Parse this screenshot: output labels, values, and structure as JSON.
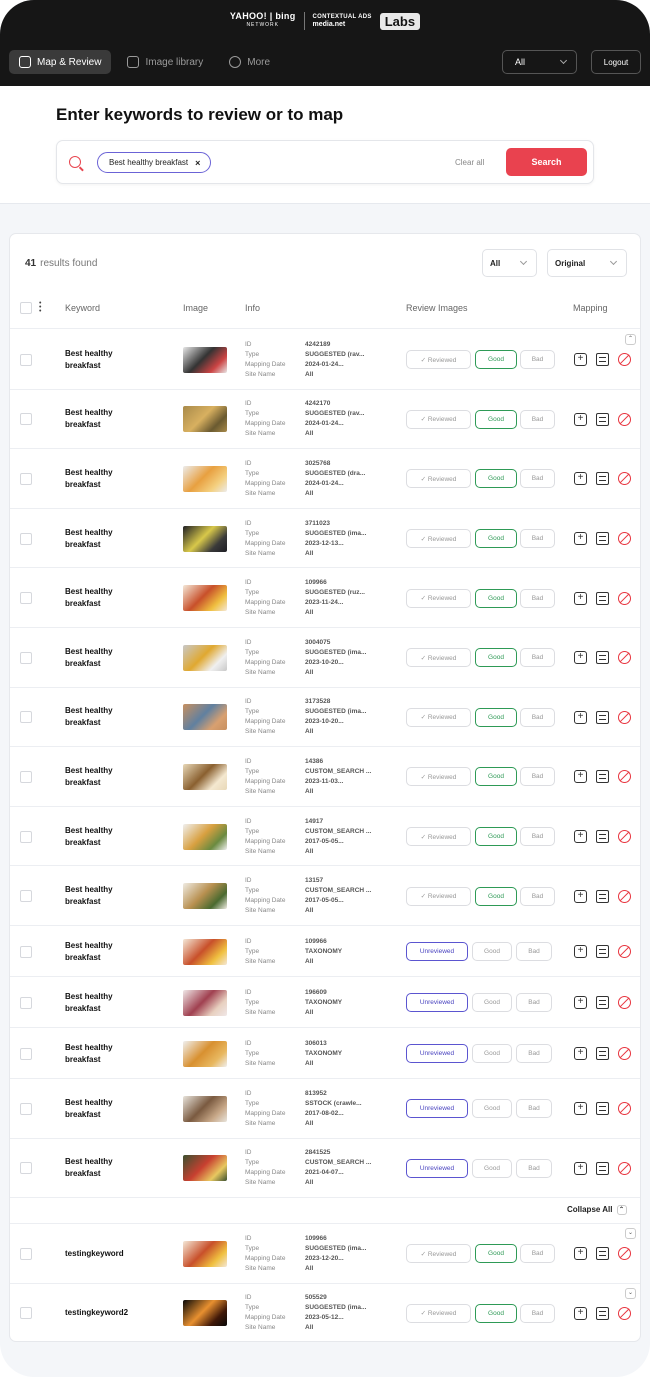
{
  "brand": {
    "yahoo_bing": "YAHOO! | bing",
    "network": "NETWORK",
    "contextual_ads": "CONTEXTUAL ADS",
    "powered_by": "media.net",
    "labs": "Labs"
  },
  "nav": {
    "items": [
      {
        "label": "Map & Review",
        "icon": "map-icon",
        "active": true
      },
      {
        "label": "Image library",
        "icon": "image-icon",
        "active": false
      },
      {
        "label": "More",
        "icon": "more-icon",
        "active": false
      }
    ],
    "select_value": "All",
    "logout_label": "Logout"
  },
  "search": {
    "title": "Enter keywords to review or to map",
    "chip": "Best healthy breakfast",
    "clear_label": "Clear all",
    "search_label": "Search"
  },
  "results": {
    "count": "41",
    "count_label": "results found",
    "filter_status": "All",
    "filter_source": "Original",
    "headers": [
      "Keyword",
      "Image",
      "Info",
      "Review Images",
      "Mapping"
    ],
    "info_labels": [
      "ID",
      "Type",
      "Mapping Date",
      "Site Name"
    ],
    "collapse_all": "Collapse All",
    "button_labels": {
      "reviewed": "Reviewed",
      "unreviewed": "Unreviewed",
      "good": "Good",
      "bad": "Bad"
    },
    "colors": {
      "accent": "#e9424f",
      "good": "#2e9a56",
      "unreviewed": "#5b55d0"
    },
    "rows": [
      {
        "keyword": "Best healthy breakfast",
        "id": "4242189",
        "type": "SUGGESTED (rav...",
        "date": "2024-01-24...",
        "site": "All",
        "status": "reviewed",
        "img": [
          "#e8e8e8",
          "#333",
          "#c44"
        ]
      },
      {
        "keyword": "Best healthy breakfast",
        "id": "4242170",
        "type": "SUGGESTED (rav...",
        "date": "2024-01-24...",
        "site": "All",
        "status": "reviewed",
        "img": [
          "#a88a4a",
          "#d8b060",
          "#6a5a30"
        ]
      },
      {
        "keyword": "Best healthy breakfast",
        "id": "3025768",
        "type": "SUGGESTED (dra...",
        "date": "2024-01-24...",
        "site": "All",
        "status": "reviewed",
        "img": [
          "#ececec",
          "#e8a040",
          "#f4d080"
        ]
      },
      {
        "keyword": "Best healthy breakfast",
        "id": "3711023",
        "type": "SUGGESTED (ima...",
        "date": "2023-12-13...",
        "site": "All",
        "status": "reviewed",
        "img": [
          "#1e1e24",
          "#d8c84a",
          "#3a3a3a"
        ]
      },
      {
        "keyword": "Best healthy breakfast",
        "id": "109966",
        "type": "SUGGESTED (ruz...",
        "date": "2023-11-24...",
        "site": "All",
        "status": "reviewed",
        "img": [
          "#f4e8d8",
          "#c8502a",
          "#f0c040"
        ]
      },
      {
        "keyword": "Best healthy breakfast",
        "id": "3004075",
        "type": "SUGGESTED (ima...",
        "date": "2023-10-20...",
        "site": "All",
        "status": "reviewed",
        "img": [
          "#c8c8c8",
          "#e0a830",
          "#f0f0f0"
        ]
      },
      {
        "keyword": "Best healthy breakfast",
        "id": "3173528",
        "type": "SUGGESTED (ima...",
        "date": "2023-10-20...",
        "site": "All",
        "status": "reviewed",
        "img": [
          "#c89060",
          "#6080a0",
          "#d8a070"
        ]
      },
      {
        "keyword": "Best healthy breakfast",
        "id": "14386",
        "type": "CUSTOM_SEARCH ...",
        "date": "2023-11-03...",
        "site": "All",
        "status": "reviewed",
        "img": [
          "#e8d8b8",
          "#8a6030",
          "#f4e8d0"
        ]
      },
      {
        "keyword": "Best healthy breakfast",
        "id": "14917",
        "type": "CUSTOM_SEARCH ...",
        "date": "2017-05-05...",
        "site": "All",
        "status": "reviewed",
        "img": [
          "#f0f0f0",
          "#d8a040",
          "#6a8a40"
        ]
      },
      {
        "keyword": "Best healthy breakfast",
        "id": "13157",
        "type": "CUSTOM_SEARCH ...",
        "date": "2017-05-05...",
        "site": "All",
        "status": "reviewed",
        "img": [
          "#f0ece4",
          "#b89050",
          "#4a6a30"
        ]
      },
      {
        "keyword": "Best healthy breakfast",
        "id": "109966",
        "type": "TAXONOMY",
        "date": "",
        "site": "All",
        "status": "unreviewed",
        "img": [
          "#f4e8d8",
          "#c8502a",
          "#f0c040"
        ]
      },
      {
        "keyword": "Best healthy breakfast",
        "id": "196609",
        "type": "TAXONOMY",
        "date": "",
        "site": "All",
        "status": "unreviewed",
        "img": [
          "#f0e8e8",
          "#a04050",
          "#e8d0c0"
        ]
      },
      {
        "keyword": "Best healthy breakfast",
        "id": "306013",
        "type": "TAXONOMY",
        "date": "",
        "site": "All",
        "status": "unreviewed",
        "img": [
          "#f0f0f0",
          "#d89030",
          "#e8b860"
        ]
      },
      {
        "keyword": "Best healthy breakfast",
        "id": "813952",
        "type": "SSTOCK (crawle...",
        "date": "2017-08-02...",
        "site": "All",
        "status": "unreviewed",
        "img": [
          "#e8e4dc",
          "#7a5a40",
          "#c8a888"
        ]
      },
      {
        "keyword": "Best healthy breakfast",
        "id": "2841525",
        "type": "CUSTOM_SEARCH ...",
        "date": "2021-04-07...",
        "site": "All",
        "status": "unreviewed",
        "img": [
          "#3a5030",
          "#c84030",
          "#e8c860"
        ]
      }
    ],
    "group_rows": [
      {
        "keyword": "testingkeyword",
        "id": "109966",
        "type": "SUGGESTED (ima...",
        "date": "2023-12-20...",
        "site": "All",
        "status": "reviewed",
        "img": [
          "#f4e8d8",
          "#c8502a",
          "#f0c040"
        ]
      },
      {
        "keyword": "testingkeyword2",
        "id": "505529",
        "type": "SUGGESTED (ima...",
        "date": "2023-05-12...",
        "site": "All",
        "status": "reviewed",
        "img": [
          "#080808",
          "#e89030",
          "#401808"
        ]
      }
    ]
  }
}
